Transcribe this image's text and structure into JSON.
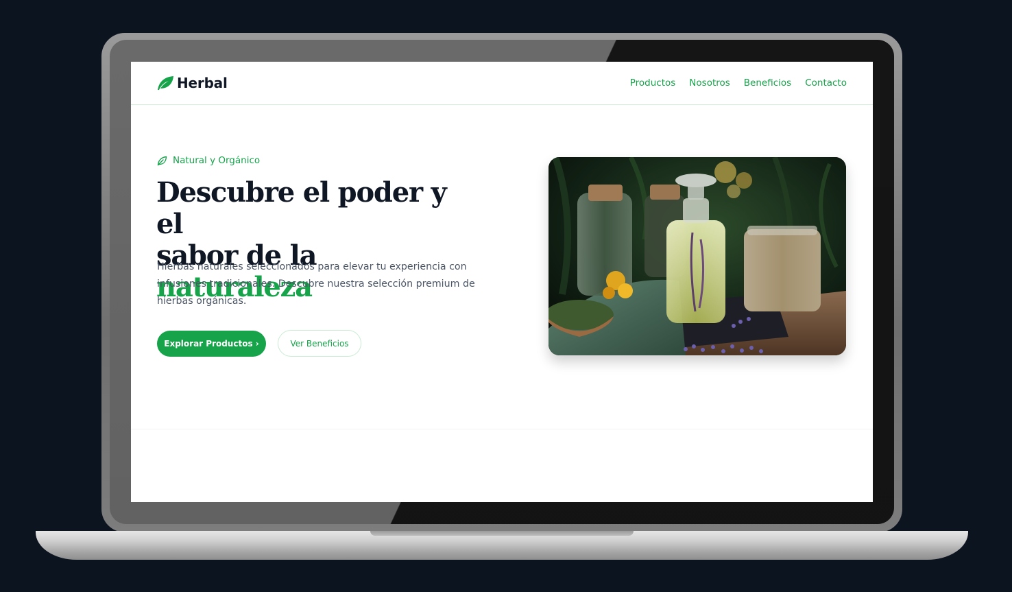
{
  "brand": {
    "name": "Herbal",
    "logo_icon": "leaf-icon",
    "accent_color": "#16a34a",
    "text_color": "#0f1724"
  },
  "nav": {
    "items": [
      {
        "label": "Productos"
      },
      {
        "label": "Nosotros"
      },
      {
        "label": "Beneficios"
      },
      {
        "label": "Contacto"
      }
    ]
  },
  "hero": {
    "eyebrow": "Natural y Orgánico",
    "eyebrow_icon": "leaf-outline-icon",
    "headline_line1": "Descubre el poder y el",
    "headline_line2_prefix": "sabor de la ",
    "headline_accent": "naturaleza",
    "description": "Hierbas naturales seleccionados para elevar tu experiencia con infusiones tradicionales. Descubre nuestra selección premium de hierbas orgánicas.",
    "primary_button": "Explorar Productos ›",
    "secondary_button": "Ver Beneficios"
  },
  "device": {
    "frame": "laptop",
    "background_color": "#0c1420"
  }
}
